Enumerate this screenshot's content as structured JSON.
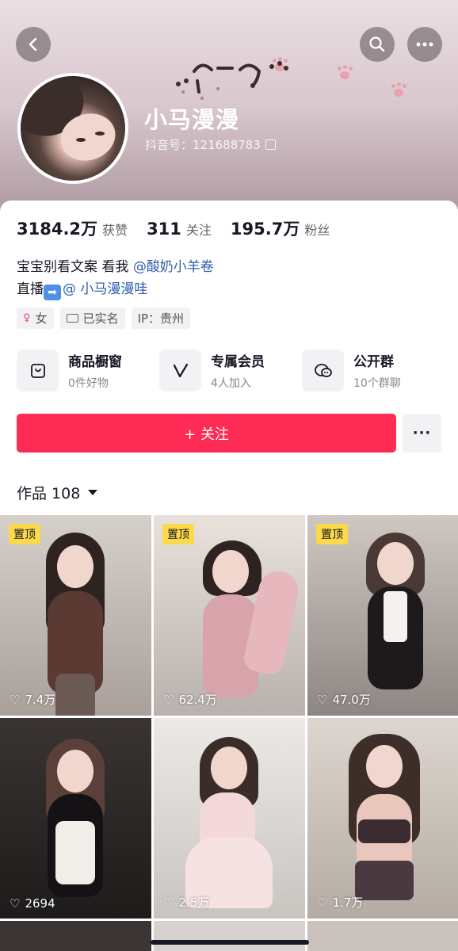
{
  "header": {
    "nickname": "小马漫漫",
    "douyin_id": "抖音号：121688783"
  },
  "icons": {
    "back": "back-arrow-icon",
    "search": "search-icon",
    "more": "more-dots-icon",
    "copy": "copy-icon"
  },
  "stats": [
    {
      "value": "3184.2万",
      "label": "获赞"
    },
    {
      "value": "311",
      "label": "关注"
    },
    {
      "value": "195.7万",
      "label": "粉丝"
    }
  ],
  "bio": {
    "line1_text": "宝宝别看文案 看我",
    "line1_mention": "@酸奶小羊卷",
    "line2_text": "直播",
    "line2_arrow": "➡",
    "line2_mention": "@ 小马漫漫哇"
  },
  "tags": [
    {
      "symbol": "♀",
      "label": "女"
    },
    {
      "label": "已实名"
    },
    {
      "label": "IP：贵州"
    }
  ],
  "features": [
    {
      "title": "商品橱窗",
      "subtitle": "0件好物",
      "icon": "shop-bag-icon"
    },
    {
      "title": "专属会员",
      "subtitle": "4人加入",
      "icon": "vip-v-icon"
    },
    {
      "title": "公开群",
      "subtitle": "10个群聊",
      "icon": "group-chat-icon"
    }
  ],
  "actions": {
    "follow_label": "+ 关注",
    "more_label": "···"
  },
  "works": {
    "label": "作品 108"
  },
  "videos": [
    {
      "pinned": "置顶",
      "likes": "7.4万"
    },
    {
      "pinned": "置顶",
      "likes": "62.4万"
    },
    {
      "pinned": "置顶",
      "likes": "47.0万"
    },
    {
      "pinned": "",
      "likes": "2694"
    },
    {
      "pinned": "",
      "likes": "2.5万"
    },
    {
      "pinned": "",
      "likes": "1.7万"
    }
  ],
  "colors": {
    "accent": "#fe2c55",
    "pin_badge": "#fbd94a",
    "mention": "#2c5ea7"
  }
}
